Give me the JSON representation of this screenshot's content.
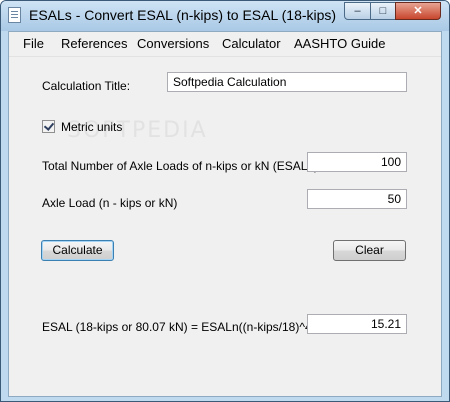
{
  "window": {
    "title": "ESALs -  Convert ESAL (n-kips) to ESAL (18-kips)",
    "app_icon": "document-icon",
    "controls": {
      "minimize": "–",
      "maximize": "□",
      "close": "✕"
    },
    "colors": {
      "titlebar": "#bfd9ee",
      "close_button": "#c7462d"
    }
  },
  "menu": {
    "items": [
      "File",
      "References",
      "Conversions",
      "Calculator",
      "AASHTO Guide"
    ]
  },
  "form": {
    "calc_title_label": "Calculation Title:",
    "calc_title_value": "Softpedia Calculation",
    "metric_label": "Metric units",
    "metric_checked": true,
    "total_axle_label": "Total Number of Axle Loads of n-kips or kN (ESALn)",
    "total_axle_value": "100",
    "axle_load_label": "Axle Load (n - kips or kN)",
    "axle_load_value": "50",
    "calculate_label": "Calculate",
    "clear_label": "Clear",
    "result_label": "ESAL (18-kips or 80.07 kN) = ESALn((n-kips/18)^4) =",
    "result_value": "15.21"
  },
  "watermark": "SOFTPEDIA"
}
